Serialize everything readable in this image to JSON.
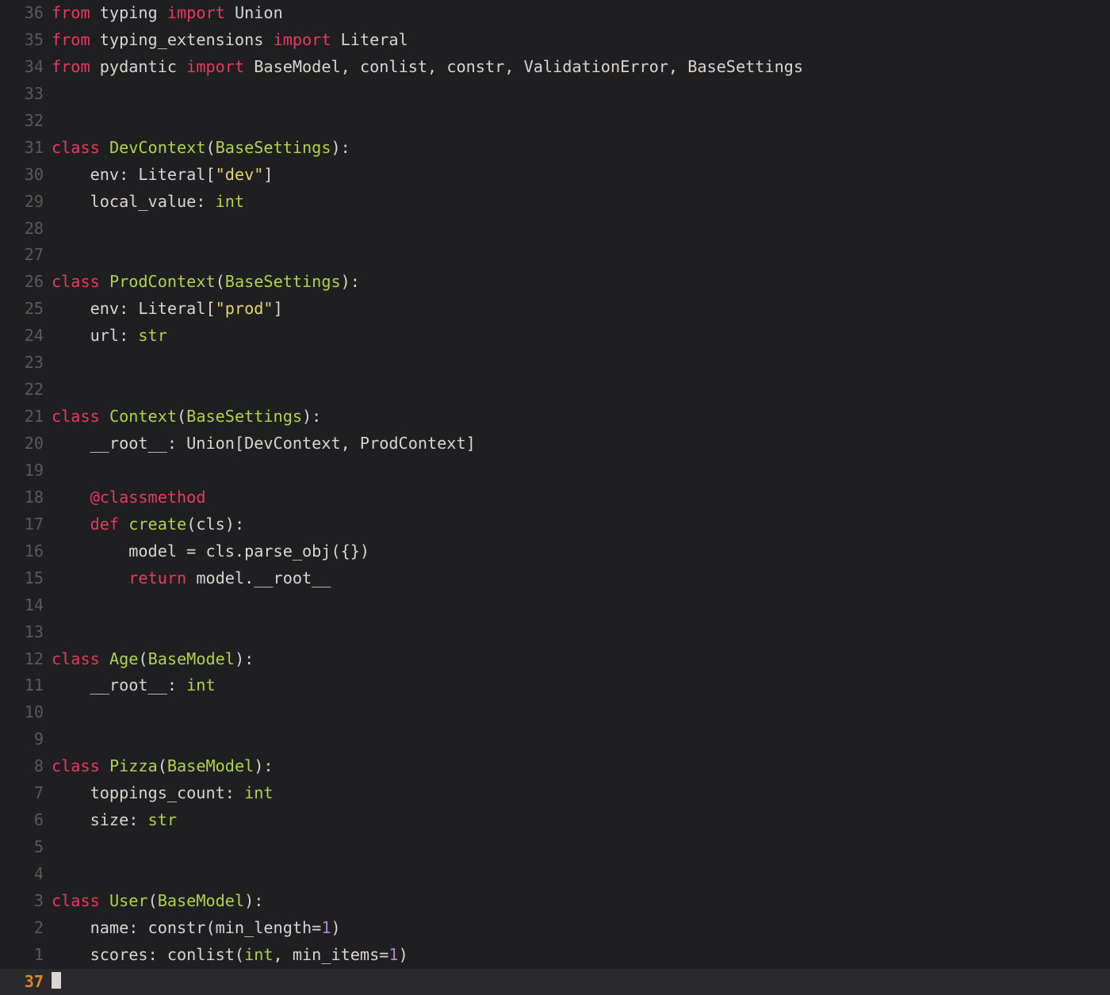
{
  "editor": {
    "current_line_number": "37",
    "lines": [
      {
        "n": "36",
        "tokens": [
          {
            "c": "tk-kw",
            "t": "from"
          },
          {
            "c": "tk-id",
            "t": " typing "
          },
          {
            "c": "tk-kw",
            "t": "import"
          },
          {
            "c": "tk-id",
            "t": " Union"
          }
        ]
      },
      {
        "n": "35",
        "tokens": [
          {
            "c": "tk-kw",
            "t": "from"
          },
          {
            "c": "tk-id",
            "t": " typing_extensions "
          },
          {
            "c": "tk-kw",
            "t": "import"
          },
          {
            "c": "tk-id",
            "t": " Literal"
          }
        ]
      },
      {
        "n": "34",
        "tokens": [
          {
            "c": "tk-kw",
            "t": "from"
          },
          {
            "c": "tk-id",
            "t": " pydantic "
          },
          {
            "c": "tk-kw",
            "t": "import"
          },
          {
            "c": "tk-id",
            "t": " BaseModel, conlist, constr, ValidationError, BaseSettings"
          }
        ]
      },
      {
        "n": "33",
        "tokens": []
      },
      {
        "n": "32",
        "tokens": []
      },
      {
        "n": "31",
        "tokens": [
          {
            "c": "tk-kw",
            "t": "class"
          },
          {
            "c": "tk-id",
            "t": " "
          },
          {
            "c": "tk-fn",
            "t": "DevContext"
          },
          {
            "c": "tk-punc",
            "t": "("
          },
          {
            "c": "tk-type",
            "t": "BaseSettings"
          },
          {
            "c": "tk-punc",
            "t": "):"
          }
        ]
      },
      {
        "n": "30",
        "tokens": [
          {
            "c": "tk-id",
            "t": "    env: Literal["
          },
          {
            "c": "tk-str",
            "t": "\"dev\""
          },
          {
            "c": "tk-id",
            "t": "]"
          }
        ]
      },
      {
        "n": "29",
        "tokens": [
          {
            "c": "tk-id",
            "t": "    local_value: "
          },
          {
            "c": "tk-type",
            "t": "int"
          }
        ]
      },
      {
        "n": "28",
        "tokens": []
      },
      {
        "n": "27",
        "tokens": []
      },
      {
        "n": "26",
        "tokens": [
          {
            "c": "tk-kw",
            "t": "class"
          },
          {
            "c": "tk-id",
            "t": " "
          },
          {
            "c": "tk-fn",
            "t": "ProdContext"
          },
          {
            "c": "tk-punc",
            "t": "("
          },
          {
            "c": "tk-type",
            "t": "BaseSettings"
          },
          {
            "c": "tk-punc",
            "t": "):"
          }
        ]
      },
      {
        "n": "25",
        "tokens": [
          {
            "c": "tk-id",
            "t": "    env: Literal["
          },
          {
            "c": "tk-str",
            "t": "\"prod\""
          },
          {
            "c": "tk-id",
            "t": "]"
          }
        ]
      },
      {
        "n": "24",
        "tokens": [
          {
            "c": "tk-id",
            "t": "    url: "
          },
          {
            "c": "tk-type",
            "t": "str"
          }
        ]
      },
      {
        "n": "23",
        "tokens": []
      },
      {
        "n": "22",
        "tokens": []
      },
      {
        "n": "21",
        "tokens": [
          {
            "c": "tk-kw",
            "t": "class"
          },
          {
            "c": "tk-id",
            "t": " "
          },
          {
            "c": "tk-fn",
            "t": "Context"
          },
          {
            "c": "tk-punc",
            "t": "("
          },
          {
            "c": "tk-type",
            "t": "BaseSettings"
          },
          {
            "c": "tk-punc",
            "t": "):"
          }
        ]
      },
      {
        "n": "20",
        "tokens": [
          {
            "c": "tk-id",
            "t": "    __root__: Union[DevContext, ProdContext]"
          }
        ]
      },
      {
        "n": "19",
        "tokens": []
      },
      {
        "n": "18",
        "tokens": [
          {
            "c": "tk-id",
            "t": "    "
          },
          {
            "c": "tk-deco",
            "t": "@classmethod"
          }
        ]
      },
      {
        "n": "17",
        "tokens": [
          {
            "c": "tk-id",
            "t": "    "
          },
          {
            "c": "tk-kw",
            "t": "def"
          },
          {
            "c": "tk-id",
            "t": " "
          },
          {
            "c": "tk-fn",
            "t": "create"
          },
          {
            "c": "tk-punc",
            "t": "(cls):"
          }
        ]
      },
      {
        "n": "16",
        "tokens": [
          {
            "c": "tk-id",
            "t": "        model = cls.parse_obj({})"
          }
        ]
      },
      {
        "n": "15",
        "tokens": [
          {
            "c": "tk-id",
            "t": "        "
          },
          {
            "c": "tk-kw",
            "t": "return"
          },
          {
            "c": "tk-id",
            "t": " model.__root__"
          }
        ]
      },
      {
        "n": "14",
        "tokens": []
      },
      {
        "n": "13",
        "tokens": []
      },
      {
        "n": "12",
        "tokens": [
          {
            "c": "tk-kw",
            "t": "class"
          },
          {
            "c": "tk-id",
            "t": " "
          },
          {
            "c": "tk-fn",
            "t": "Age"
          },
          {
            "c": "tk-punc",
            "t": "("
          },
          {
            "c": "tk-type",
            "t": "BaseModel"
          },
          {
            "c": "tk-punc",
            "t": "):"
          }
        ]
      },
      {
        "n": "11",
        "tokens": [
          {
            "c": "tk-id",
            "t": "    __root__: "
          },
          {
            "c": "tk-type",
            "t": "int"
          }
        ]
      },
      {
        "n": "10",
        "tokens": []
      },
      {
        "n": "9",
        "tokens": []
      },
      {
        "n": "8",
        "tokens": [
          {
            "c": "tk-kw",
            "t": "class"
          },
          {
            "c": "tk-id",
            "t": " "
          },
          {
            "c": "tk-fn",
            "t": "Pizza"
          },
          {
            "c": "tk-punc",
            "t": "("
          },
          {
            "c": "tk-type",
            "t": "BaseModel"
          },
          {
            "c": "tk-punc",
            "t": "):"
          }
        ]
      },
      {
        "n": "7",
        "tokens": [
          {
            "c": "tk-id",
            "t": "    toppings_count: "
          },
          {
            "c": "tk-type",
            "t": "int"
          }
        ]
      },
      {
        "n": "6",
        "tokens": [
          {
            "c": "tk-id",
            "t": "    size: "
          },
          {
            "c": "tk-type",
            "t": "str"
          }
        ]
      },
      {
        "n": "5",
        "tokens": []
      },
      {
        "n": "4",
        "tokens": []
      },
      {
        "n": "3",
        "tokens": [
          {
            "c": "tk-kw",
            "t": "class"
          },
          {
            "c": "tk-id",
            "t": " "
          },
          {
            "c": "tk-fn",
            "t": "User"
          },
          {
            "c": "tk-punc",
            "t": "("
          },
          {
            "c": "tk-type",
            "t": "BaseModel"
          },
          {
            "c": "tk-punc",
            "t": "):"
          }
        ]
      },
      {
        "n": "2",
        "tokens": [
          {
            "c": "tk-id",
            "t": "    name: constr(min_length="
          },
          {
            "c": "tk-num",
            "t": "1"
          },
          {
            "c": "tk-id",
            "t": ")"
          }
        ]
      },
      {
        "n": "1",
        "tokens": [
          {
            "c": "tk-id",
            "t": "    scores: conlist("
          },
          {
            "c": "tk-type",
            "t": "int"
          },
          {
            "c": "tk-id",
            "t": ", min_items="
          },
          {
            "c": "tk-num",
            "t": "1"
          },
          {
            "c": "tk-id",
            "t": ")"
          }
        ]
      }
    ]
  }
}
